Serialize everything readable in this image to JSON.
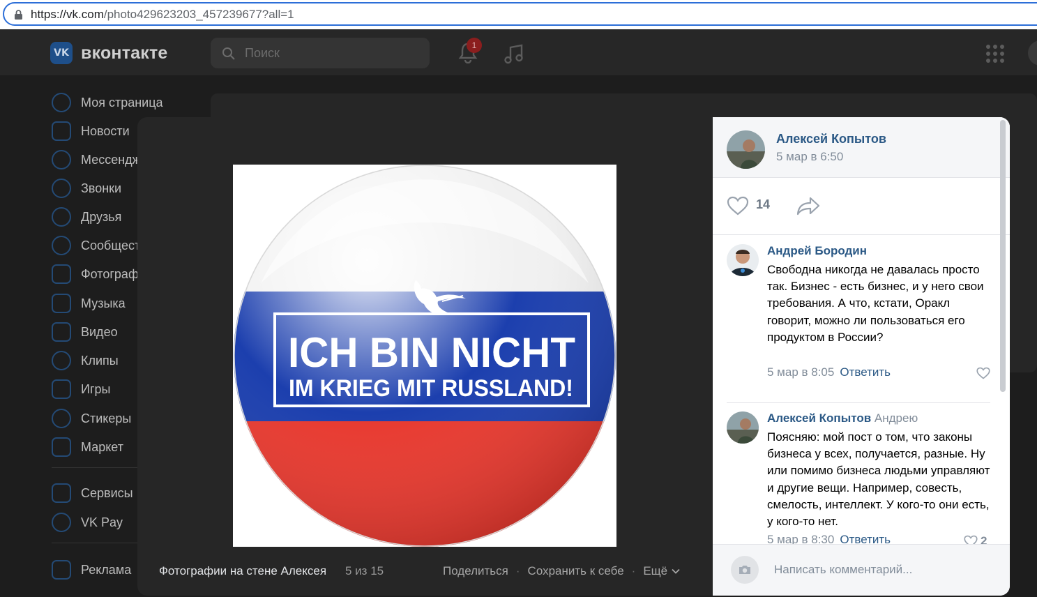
{
  "browser": {
    "url_host": "https://vk.com",
    "url_path": "/photo429623203_457239677?all=1"
  },
  "vk": {
    "logo_text": "VK",
    "brand": "вконтакте",
    "search_placeholder": "Поиск",
    "notification_count": "1",
    "sidebar": [
      {
        "label": "Моя страница",
        "icon": "user-circle-icon"
      },
      {
        "label": "Новости",
        "icon": "news-icon"
      },
      {
        "label": "Мессенджер",
        "icon": "message-icon"
      },
      {
        "label": "Звонки",
        "icon": "phone-icon"
      },
      {
        "label": "Друзья",
        "icon": "friends-icon"
      },
      {
        "label": "Сообщества",
        "icon": "groups-icon"
      },
      {
        "label": "Фотографии",
        "icon": "photo-icon"
      },
      {
        "label": "Музыка",
        "icon": "music-icon"
      },
      {
        "label": "Видео",
        "icon": "video-icon"
      },
      {
        "label": "Клипы",
        "icon": "clips-icon"
      },
      {
        "label": "Игры",
        "icon": "games-icon"
      },
      {
        "label": "Стикеры",
        "icon": "stickers-icon"
      },
      {
        "label": "Маркет",
        "icon": "market-icon"
      },
      {
        "label": "Сервисы",
        "icon": "services-icon"
      },
      {
        "label": "VK Pay",
        "icon": "vkpay-icon"
      },
      {
        "label": "Реклама",
        "icon": "ads-icon"
      }
    ]
  },
  "viewer": {
    "photo_text_line1": "ICH BIN NICHT",
    "photo_text_line2": "IM KRIEG MIT RUSSLAND!",
    "album_title": "Фотографии на стене Алексея",
    "counter": "5 из 15",
    "actions": {
      "share": "Поделиться",
      "save": "Сохранить к себе",
      "more": "Ещё"
    }
  },
  "panel": {
    "author": "Алексей Копытов",
    "date": "5 мар в 6:50",
    "likes": "14",
    "comments": [
      {
        "author": "Андрей Бородин",
        "reply_to": "",
        "text": "Свободна никогда не давалась просто так. Бизнес - есть бизнес, и у него свои требования. А что, кстати, Оракл говорит, можно ли пользоваться его продуктом в России?",
        "date": "5 мар в 8:05",
        "reply_label": "Ответить",
        "likes": ""
      },
      {
        "author": "Алексей Копытов",
        "reply_to": "Андрею",
        "text": "Поясняю: мой пост о том, что законы бизнеса у всех, получается, разные. Ну или помимо бизнеса людьми управляют и другие вещи. Например, совесть, смелость, интеллект. У кого-то они есть, у кого-то нет.",
        "date": "5 мар в 8:30",
        "reply_label": "Ответить",
        "likes": "2"
      }
    ],
    "composer_placeholder": "Написать комментарий..."
  },
  "colors": {
    "link": "#2a5885",
    "meta": "#818c99",
    "flag_blue": "#1c3fae",
    "flag_red": "#e8392f",
    "browser_focus": "#2c6ed8"
  }
}
